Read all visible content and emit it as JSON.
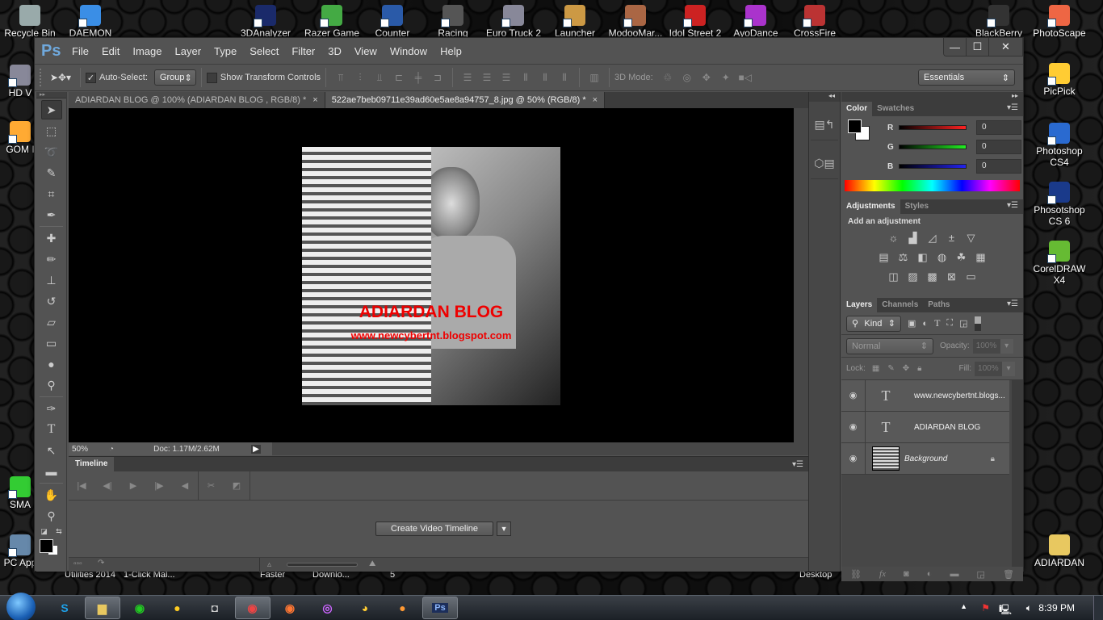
{
  "desktop": {
    "top_icons": [
      {
        "label": "Recycle Bin",
        "icon": "recycle-bin-icon",
        "color": "#9aa"
      },
      {
        "label": "DAEMON",
        "icon": "daemon-tools-icon",
        "color": "#3a8ee6"
      },
      {
        "label": "3DAnalyzer",
        "icon": "3danalyzer-icon",
        "color": "#1a2a6a"
      },
      {
        "label": "Razer Game",
        "icon": "razer-game-icon",
        "color": "#4a4"
      },
      {
        "label": "Counter",
        "icon": "counter-icon",
        "color": "#2a5aa8"
      },
      {
        "label": "Racing",
        "icon": "racing-flag-icon",
        "color": "#555"
      },
      {
        "label": "Euro Truck 2",
        "icon": "truck-icon",
        "color": "#889"
      },
      {
        "label": "Launcher",
        "icon": "launcher-icon",
        "color": "#c94"
      },
      {
        "label": "ModooMar...",
        "icon": "modoo-icon",
        "color": "#a64"
      },
      {
        "label": "Idol Street 2",
        "icon": "idol-street-icon",
        "color": "#c22"
      },
      {
        "label": "AyoDance",
        "icon": "ayodance-icon",
        "color": "#a3c"
      },
      {
        "label": "CrossFire",
        "icon": "crossfire-icon",
        "color": "#b33"
      },
      {
        "label": "BlackBerry",
        "icon": "blackberry-icon",
        "color": "#333"
      },
      {
        "label": "PhotoScape",
        "icon": "photoscape-icon",
        "color": "#e64"
      }
    ],
    "left_icons": [
      {
        "label": "HD V",
        "icon": "hd-video-icon",
        "color": "#889"
      },
      {
        "label": "GOM I",
        "icon": "gom-player-icon",
        "color": "#fa3"
      },
      {
        "label": "SMA",
        "icon": "sma-icon",
        "color": "#3c3"
      },
      {
        "label": "PC App",
        "icon": "pc-app-icon",
        "color": "#68a"
      }
    ],
    "right_icons": [
      {
        "label": "PicPick",
        "icon": "picpick-icon",
        "color": "#fc3"
      },
      {
        "label": "Photoshop CS4",
        "icon": "photoshop-cs4-icon",
        "color": "#2a6ad0"
      },
      {
        "label": "Phosotshop CS 6",
        "icon": "photoshop-cs6-icon",
        "color": "#1a3a8a"
      },
      {
        "label": "CorelDRAW X4",
        "icon": "coreldraw-icon",
        "color": "#6b3"
      },
      {
        "label": "ADIARDAN",
        "icon": "folder-icon",
        "color": "#e8c860"
      }
    ],
    "behind_labels": [
      "Utilities 2014",
      "1-Click Mal...",
      "Faster",
      "Downlo...",
      "5",
      "Desktop"
    ]
  },
  "photoshop": {
    "logo": "Ps",
    "menu": [
      "File",
      "Edit",
      "Image",
      "Layer",
      "Type",
      "Select",
      "Filter",
      "3D",
      "View",
      "Window",
      "Help"
    ],
    "window_controls": {
      "minimize": "—",
      "maximize": "☐",
      "close": "✕"
    },
    "options": {
      "auto_select_label": "Auto-Select:",
      "auto_select_checked": true,
      "auto_select_value": "Group",
      "show_transform_label": "Show Transform Controls",
      "show_transform_checked": false,
      "mode_3d_label": "3D Mode:",
      "workspace": "Essentials"
    },
    "tabs": [
      {
        "label": "ADIARDAN BLOG @ 100% (ADIARDAN BLOG , RGB/8) *",
        "active": false
      },
      {
        "label": "522ae7beb09711e39ad60e5ae8a94757_8.jpg @ 50% (RGB/8) *",
        "active": true
      }
    ],
    "canvas": {
      "title_text": "ADIARDAN BLOG",
      "url_text": "www.newcybertnt.blogspot.com"
    },
    "status": {
      "zoom": "50%",
      "doc": "Doc: 1.17M/2.62M"
    },
    "timeline": {
      "title": "Timeline",
      "create_button": "Create Video Timeline"
    },
    "color_panel": {
      "tabs": [
        "Color",
        "Swatches"
      ],
      "r": "0",
      "g": "0",
      "b": "0",
      "labels": {
        "r": "R",
        "g": "G",
        "b": "B"
      },
      "foreground": "#000000",
      "background": "#ffffff"
    },
    "adjustments_panel": {
      "tabs": [
        "Adjustments",
        "Styles"
      ],
      "heading": "Add an adjustment"
    },
    "layers_panel": {
      "tabs": [
        "Layers",
        "Channels",
        "Paths"
      ],
      "filter_kind": "Kind",
      "blend_mode": "Normal",
      "opacity_label": "Opacity:",
      "opacity": "100%",
      "lock_label": "Lock:",
      "fill_label": "Fill:",
      "fill": "100%",
      "layers": [
        {
          "name": "www.newcybertnt.blogs...",
          "type": "text",
          "visible": true
        },
        {
          "name": "ADIARDAN BLOG",
          "type": "text",
          "visible": true
        },
        {
          "name": "Background",
          "type": "image",
          "visible": true,
          "locked": true
        }
      ]
    }
  },
  "taskbar": {
    "clock": "8:39 PM",
    "apps": [
      {
        "name": "skype",
        "icon": "skype-icon",
        "open": false
      },
      {
        "name": "explorer",
        "icon": "folder-icon",
        "open": true
      },
      {
        "name": "line",
        "icon": "line-icon",
        "open": false
      },
      {
        "name": "kakaotalk",
        "icon": "kakaotalk-icon",
        "open": false
      },
      {
        "name": "instagram-uploader",
        "icon": "camera-icon",
        "open": false
      },
      {
        "name": "chrome",
        "icon": "chrome-icon",
        "open": true
      },
      {
        "name": "firefox",
        "icon": "firefox-icon",
        "open": false
      },
      {
        "name": "uc-app",
        "icon": "swirl-icon",
        "open": false
      },
      {
        "name": "picpick",
        "icon": "palette-icon",
        "open": false
      },
      {
        "name": "gom",
        "icon": "gom-icon",
        "open": false
      },
      {
        "name": "photoshop",
        "icon": "photoshop-icon",
        "open": true
      }
    ]
  }
}
